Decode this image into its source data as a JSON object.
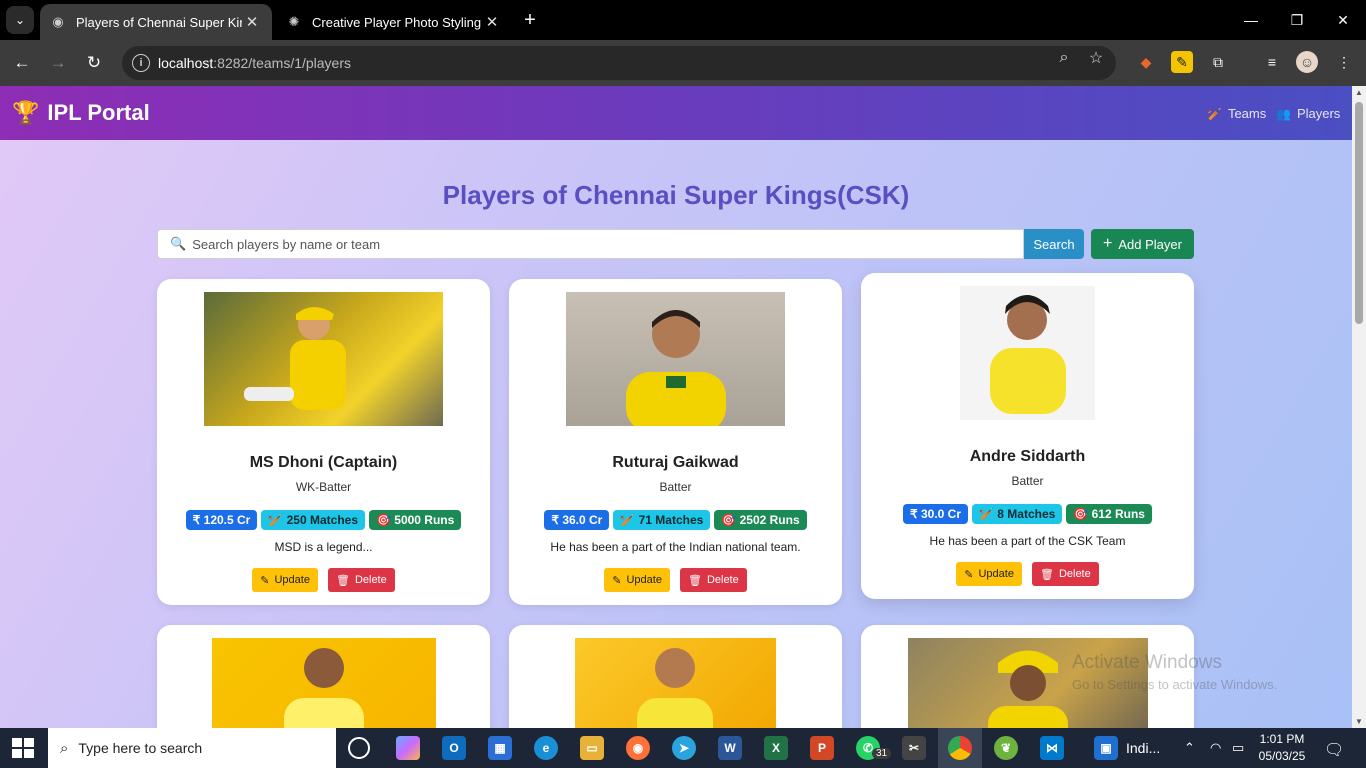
{
  "browser": {
    "tabs": [
      {
        "title": "Players of Chennai Super Kings(",
        "close": "✕"
      },
      {
        "title": "Creative Player Photo Styling",
        "close": "✕"
      }
    ],
    "new_tab": "+",
    "window": {
      "minimize": "—",
      "maximize": "❐",
      "close": "✕"
    },
    "url_host": "localhost",
    "url_path": ":8282/teams/1/players"
  },
  "app": {
    "brand": "IPL Portal",
    "nav": [
      {
        "label": "Teams",
        "icon": "bat-icon"
      },
      {
        "label": "Players",
        "icon": "users-icon"
      }
    ]
  },
  "page": {
    "title": "Players of Chennai Super Kings(CSK)",
    "search": {
      "placeholder": "Search players by name or team",
      "button": "Search"
    },
    "add_button": "Add Player"
  },
  "players": [
    {
      "name": "MS Dhoni (Captain)",
      "role": "WK-Batter",
      "price": "₹ 120.5 Cr",
      "matches": "250 Matches",
      "runs": "5000 Runs",
      "description": "MSD is a legend...",
      "update": "Update",
      "delete": "Delete",
      "photo_color": "#c9a81c"
    },
    {
      "name": "Ruturaj Gaikwad",
      "role": "Batter",
      "price": "₹ 36.0 Cr",
      "matches": "71 Matches",
      "runs": "2502 Runs",
      "description": "He has been a part of the Indian national team.",
      "update": "Update",
      "delete": "Delete",
      "photo_color": "#b9b2a6"
    },
    {
      "name": "Andre Siddarth",
      "role": "Batter",
      "price": "₹ 30.0 Cr",
      "matches": "8 Matches",
      "runs": "612 Runs",
      "description": "He has been a part of the CSK Team",
      "update": "Update",
      "delete": "Delete",
      "photo_color": "#f4f4f4"
    }
  ],
  "watermark": {
    "line1": "Activate Windows",
    "line2": "Go to Settings to activate Windows."
  },
  "taskbar": {
    "search_placeholder": "Type here to search",
    "app_label": "Indi...",
    "time": "1:01 PM",
    "date": "05/03/25",
    "whatsapp_badge": "31"
  }
}
